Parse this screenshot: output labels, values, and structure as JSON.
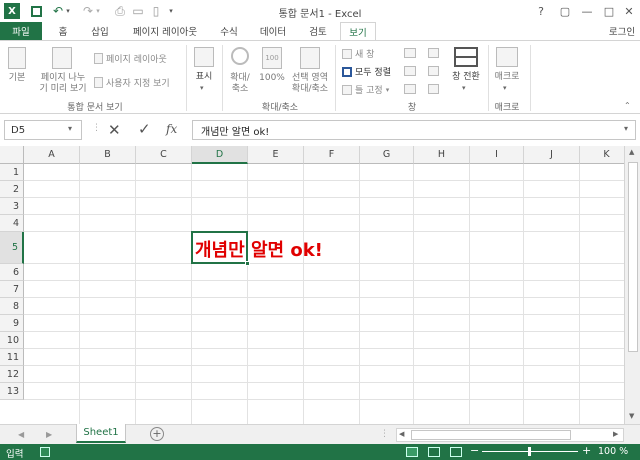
{
  "window": {
    "title": "통합 문서1 - Excel",
    "help": "?",
    "restore": "▢",
    "minimize": "—",
    "maximize": "□",
    "close": "✕"
  },
  "qat": {
    "save_icon": "save-icon",
    "undo_icon": "undo-icon",
    "redo_icon": "redo-icon"
  },
  "tabs": {
    "file": "파일",
    "home": "홈",
    "insert": "삽입",
    "page_layout": "페이지 레이아웃",
    "formulas": "수식",
    "data": "데이터",
    "review": "검토",
    "view": "보기",
    "login": "로그인"
  },
  "ribbon": {
    "normal": "기본",
    "page_break_1": "페이지 나누",
    "page_break_2": "기 미리 보기",
    "page_layout": "페이지 레이아웃",
    "custom_view": "사용자 지정 보기",
    "workbook_views_group": "통합 문서 보기",
    "show": "표시",
    "zoom_1": "확대/",
    "zoom_2": "축소",
    "zoom100": "100%",
    "zoom_sel_1": "선택 영역",
    "zoom_sel_2": "확대/축소",
    "zoom_group": "확대/축소",
    "new_window": "새 창",
    "arrange_all": "모두 정렬",
    "freeze_panes": "틀 고정",
    "window_group": "창",
    "switch_windows": "창 전환",
    "macros": "매크로",
    "macros_group": "매크로"
  },
  "formula": {
    "name_box": "D5",
    "fx": "fx",
    "content": "개념만 알면 ok!"
  },
  "columns": [
    "A",
    "B",
    "C",
    "D",
    "E",
    "F",
    "G",
    "H",
    "I",
    "J",
    "K"
  ],
  "rows": [
    "1",
    "2",
    "3",
    "4",
    "5",
    "6",
    "7",
    "8",
    "9",
    "10",
    "11",
    "12",
    "13"
  ],
  "cell": {
    "ref": "D5",
    "value": "개념만 알면 ok!",
    "color": "#e00000"
  },
  "sheets": {
    "active": "Sheet1",
    "add": "+"
  },
  "status": {
    "mode": "입력",
    "zoom": "100 %"
  },
  "colors": {
    "excel_green": "#217346"
  }
}
